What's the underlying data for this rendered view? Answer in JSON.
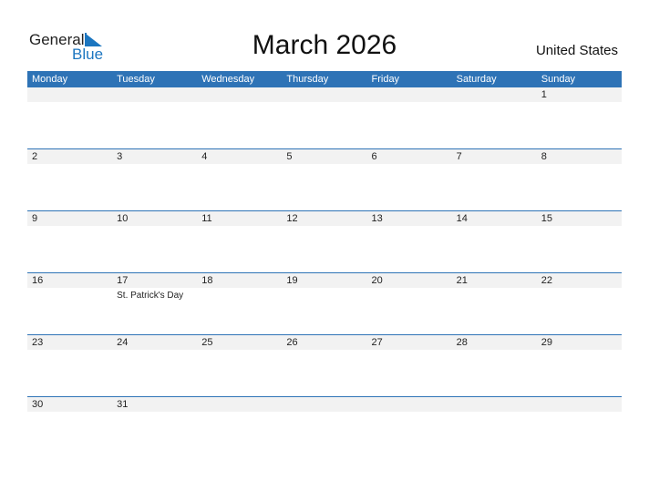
{
  "logo": {
    "general": "General",
    "blue": "Blue"
  },
  "title": "March 2026",
  "country": "United States",
  "colors": {
    "accent": "#2e73b6",
    "logo_blue": "#1c76c0",
    "date_row_bg": "#f2f2f2"
  },
  "weekdays": [
    "Monday",
    "Tuesday",
    "Wednesday",
    "Thursday",
    "Friday",
    "Saturday",
    "Sunday"
  ],
  "weeks": [
    {
      "days": [
        "",
        "",
        "",
        "",
        "",
        "",
        "1"
      ],
      "holidays": [
        "",
        "",
        "",
        "",
        "",
        "",
        ""
      ]
    },
    {
      "days": [
        "2",
        "3",
        "4",
        "5",
        "6",
        "7",
        "8"
      ],
      "holidays": [
        "",
        "",
        "",
        "",
        "",
        "",
        ""
      ]
    },
    {
      "days": [
        "9",
        "10",
        "11",
        "12",
        "13",
        "14",
        "15"
      ],
      "holidays": [
        "",
        "",
        "",
        "",
        "",
        "",
        ""
      ]
    },
    {
      "days": [
        "16",
        "17",
        "18",
        "19",
        "20",
        "21",
        "22"
      ],
      "holidays": [
        "",
        "St. Patrick's Day",
        "",
        "",
        "",
        "",
        ""
      ]
    },
    {
      "days": [
        "23",
        "24",
        "25",
        "26",
        "27",
        "28",
        "29"
      ],
      "holidays": [
        "",
        "",
        "",
        "",
        "",
        "",
        ""
      ]
    },
    {
      "days": [
        "30",
        "31",
        "",
        "",
        "",
        "",
        ""
      ],
      "holidays": [
        "",
        "",
        "",
        "",
        "",
        "",
        ""
      ]
    }
  ]
}
